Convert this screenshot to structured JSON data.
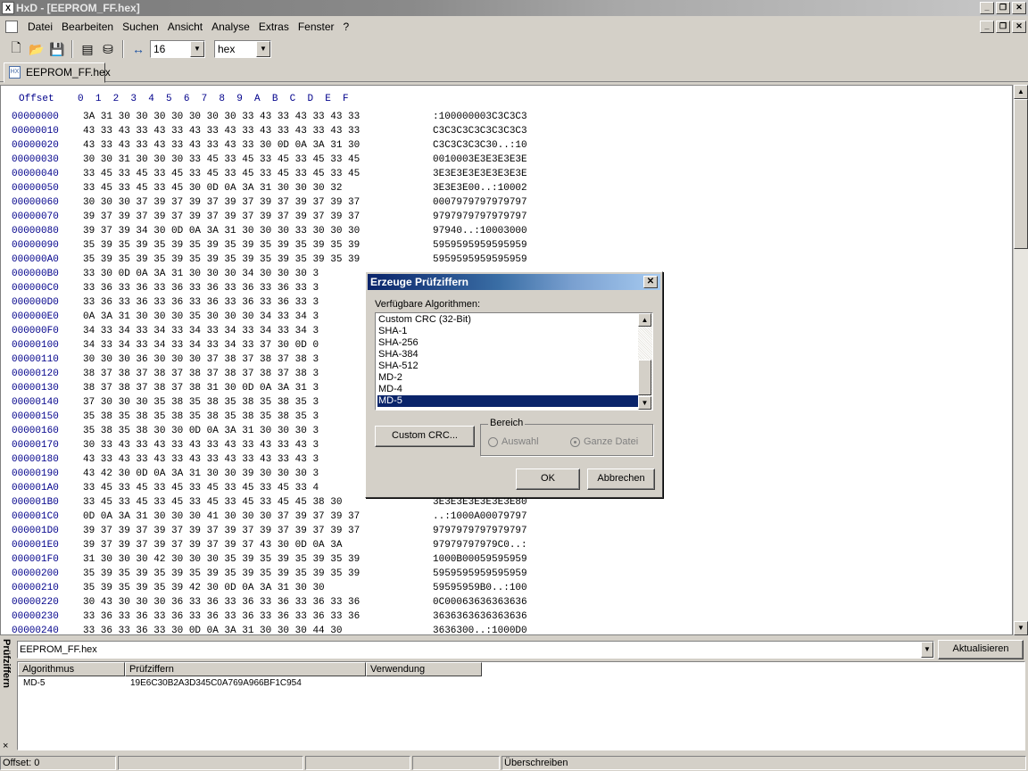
{
  "window": {
    "title": "HxD - [EEPROM_FF.hex]"
  },
  "menu": [
    "Datei",
    "Bearbeiten",
    "Suchen",
    "Ansicht",
    "Analyse",
    "Extras",
    "Fenster",
    "?"
  ],
  "toolbar": {
    "bytes_per_row": "16",
    "mode": "hex"
  },
  "tab": {
    "label": "EEPROM_FF.hex"
  },
  "hex": {
    "header": "Offset    0  1  2  3  4  5  6  7  8  9  A  B  C  D  E  F",
    "rows": [
      {
        "offset": "00000000",
        "bytes": "3A 31 30 30 30 30 30 30 30 33 43 33 43 33 43 33",
        "text": ":100000003C3C3C3"
      },
      {
        "offset": "00000010",
        "bytes": "43 33 43 33 43 33 43 33 43 33 43 33 43 33 43 33",
        "text": "C3C3C3C3C3C3C3C3"
      },
      {
        "offset": "00000020",
        "bytes": "43 33 43 33 43 33 43 33 43 33 30 0D 0A 3A 31 30",
        "text": "C3C3C3C3C30..:10"
      },
      {
        "offset": "00000030",
        "bytes": "30 30 31 30 30 30 33 45 33 45 33 45 33 45 33 45",
        "text": "0010003E3E3E3E3E"
      },
      {
        "offset": "00000040",
        "bytes": "33 45 33 45 33 45 33 45 33 45 33 45 33 45 33 45",
        "text": "3E3E3E3E3E3E3E3E"
      },
      {
        "offset": "00000050",
        "bytes": "33 45 33 45 33 45 30 0D 0A 3A 31 30 30 30 32",
        "text": "3E3E3E00..:10002"
      },
      {
        "offset": "00000060",
        "bytes": "30 30 30 37 39 37 39 37 39 37 39 37 39 37 39 37",
        "text": "0007979797979797"
      },
      {
        "offset": "00000070",
        "bytes": "39 37 39 37 39 37 39 37 39 37 39 37 39 37 39 37",
        "text": "9797979797979797"
      },
      {
        "offset": "00000080",
        "bytes": "39 37 39 34 30 0D 0A 3A 31 30 30 30 33 30 30 30",
        "text": "97940..:10003000"
      },
      {
        "offset": "00000090",
        "bytes": "35 39 35 39 35 39 35 39 35 39 35 39 35 39 35 39",
        "text": "5959595959595959"
      },
      {
        "offset": "000000A0",
        "bytes": "35 39 35 39 35 39 35 39 35 39 35 39 35 39 35 39",
        "text": "5959595959595959"
      },
      {
        "offset": "000000B0",
        "bytes": "33 30 0D 0A 3A 31 30 30 30 34 30 30 30 3",
        "text": ""
      },
      {
        "offset": "000000C0",
        "bytes": "33 36 33 36 33 36 33 36 33 36 33 36 33 3",
        "text": ""
      },
      {
        "offset": "000000D0",
        "bytes": "33 36 33 36 33 36 33 36 33 36 33 36 33 3",
        "text": ""
      },
      {
        "offset": "000000E0",
        "bytes": "0A 3A 31 30 30 30 35 30 30 30 34 33 34 3",
        "text": ""
      },
      {
        "offset": "000000F0",
        "bytes": "34 33 34 33 34 33 34 33 34 33 34 33 34 3",
        "text": ""
      },
      {
        "offset": "00000100",
        "bytes": "34 33 34 33 34 33 34 33 34 33 37 30 0D 0",
        "text": ""
      },
      {
        "offset": "00000110",
        "bytes": "30 30 30 36 30 30 30 37 38 37 38 37 38 3",
        "text": ""
      },
      {
        "offset": "00000120",
        "bytes": "38 37 38 37 38 37 38 37 38 37 38 37 38 3",
        "text": ""
      },
      {
        "offset": "00000130",
        "bytes": "38 37 38 37 38 37 38 31 30 0D 0A 3A 31 3",
        "text": ""
      },
      {
        "offset": "00000140",
        "bytes": "37 30 30 30 35 38 35 38 35 38 35 38 35 3",
        "text": ""
      },
      {
        "offset": "00000150",
        "bytes": "35 38 35 38 35 38 35 38 35 38 35 38 35 3",
        "text": ""
      },
      {
        "offset": "00000160",
        "bytes": "35 38 35 38 30 30 0D 0A 3A 31 30 30 30 3",
        "text": ""
      },
      {
        "offset": "00000170",
        "bytes": "30 33 43 33 43 33 43 33 43 33 43 33 43 3",
        "text": ""
      },
      {
        "offset": "00000180",
        "bytes": "43 33 43 33 43 33 43 33 43 33 43 33 43 3",
        "text": ""
      },
      {
        "offset": "00000190",
        "bytes": "43 42 30 0D 0A 3A 31 30 30 39 30 30 30 3",
        "text": ""
      },
      {
        "offset": "000001A0",
        "bytes": "33 45 33 45 33 45 33 45 33 45 33 45 33 4",
        "text": ""
      },
      {
        "offset": "000001B0",
        "bytes": "33 45 33 45 33 45 33 45 33 45 33 45 45 38 30",
        "text": "3E3E3E3E3E3E3E80"
      },
      {
        "offset": "000001C0",
        "bytes": "0D 0A 3A 31 30 30 30 41 30 30 30 37 39 37 39 37",
        "text": "..:1000A00079797"
      },
      {
        "offset": "000001D0",
        "bytes": "39 37 39 37 39 37 39 37 39 37 39 37 39 37 39 37",
        "text": "9797979797979797"
      },
      {
        "offset": "000001E0",
        "bytes": "39 37 39 37 39 37 39 37 39 37 43 30 0D 0A 3A",
        "text": "97979797979C0..:"
      },
      {
        "offset": "000001F0",
        "bytes": "31 30 30 30 42 30 30 30 35 39 35 39 35 39 35 39",
        "text": "1000B00059595959"
      },
      {
        "offset": "00000200",
        "bytes": "35 39 35 39 35 39 35 39 35 39 35 39 35 39 35 39",
        "text": "5959595959595959"
      },
      {
        "offset": "00000210",
        "bytes": "35 39 35 39 35 39 42 30 0D 0A 3A 31 30 30",
        "text": "59595959B0..:100"
      },
      {
        "offset": "00000220",
        "bytes": "30 43 30 30 30 36 33 36 33 36 33 36 33 36 33 36",
        "text": "0C00063636363636"
      },
      {
        "offset": "00000230",
        "bytes": "33 36 33 36 33 36 33 36 33 36 33 36 33 36 33 36",
        "text": "3636363636363636"
      },
      {
        "offset": "00000240",
        "bytes": "33 36 33 36 33 30 0D 0A 3A 31 30 30 30 44 30",
        "text": "3636300..:1000D0"
      }
    ]
  },
  "dialog": {
    "title": "Erzeuge Prüfziffern",
    "list_label": "Verfügbare Algorithmen:",
    "algorithms": [
      "Custom CRC (32-Bit)",
      "SHA-1",
      "SHA-256",
      "SHA-384",
      "SHA-512",
      "MD-2",
      "MD-4",
      "MD-5"
    ],
    "selected": "MD-5",
    "custom_crc_button": "Custom CRC...",
    "group_label": "Bereich",
    "radio_selection": "Auswahl",
    "radio_whole_file": "Ganze Datei",
    "ok_button": "OK",
    "cancel_button": "Abbrechen"
  },
  "checksum_panel": {
    "title": "Prüfziffern",
    "close": "×",
    "file": "EEPROM_FF.hex",
    "refresh_button": "Aktualisieren",
    "columns": [
      "Algorithmus",
      "Prüfziffern",
      "Verwendung"
    ],
    "rows": [
      {
        "algorithm": "MD-5",
        "checksum": "19E6C30B2A3D345C0A769A966BF1C954",
        "usage": ""
      }
    ]
  },
  "status": {
    "offset": "Offset: 0",
    "mode": "Überschreiben"
  }
}
